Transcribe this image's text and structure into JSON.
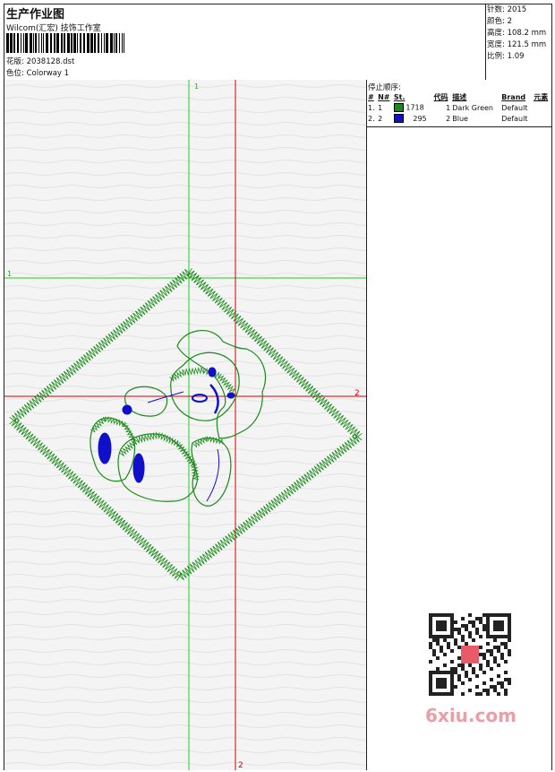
{
  "header": {
    "title": "生产作业图",
    "studio": "Wilcom(汇宏) 技饰工作室",
    "design_label": "花版:",
    "design_value": "2038128.dst",
    "colorway_label": "色位:",
    "colorway_value": "Colorway 1"
  },
  "stats": [
    {
      "label": "针数:",
      "value": "2015"
    },
    {
      "label": "颜色:",
      "value": "2"
    },
    {
      "label": "高度:",
      "value": "108.2 mm"
    },
    {
      "label": "宽度:",
      "value": "121.5 mm"
    },
    {
      "label": "比例:",
      "value": "1.09"
    }
  ],
  "guides": {
    "v_green_label": "1",
    "h_green_label": "1",
    "v_red_label": "2",
    "h_red_label": "2"
  },
  "stop_sequence": {
    "title": "停止顺序:",
    "columns": [
      "#",
      "N#",
      "St.",
      "代码",
      "描述",
      "Brand",
      "元素"
    ],
    "rows": [
      {
        "idx": "1.",
        "n": "1",
        "color": "#1a8a1a",
        "stitches": "1718",
        "code": "1",
        "desc": "Dark Green",
        "brand": "Default"
      },
      {
        "idx": "2.",
        "n": "2",
        "color": "#1010c8",
        "stitches": "295",
        "code": "2",
        "desc": "Blue",
        "brand": "Default"
      }
    ]
  },
  "watermark": "6xiu.com",
  "colors": {
    "green": "#1a8a1a",
    "blue": "#1010c8",
    "red": "#d40000",
    "guide_green": "#22cc22"
  }
}
